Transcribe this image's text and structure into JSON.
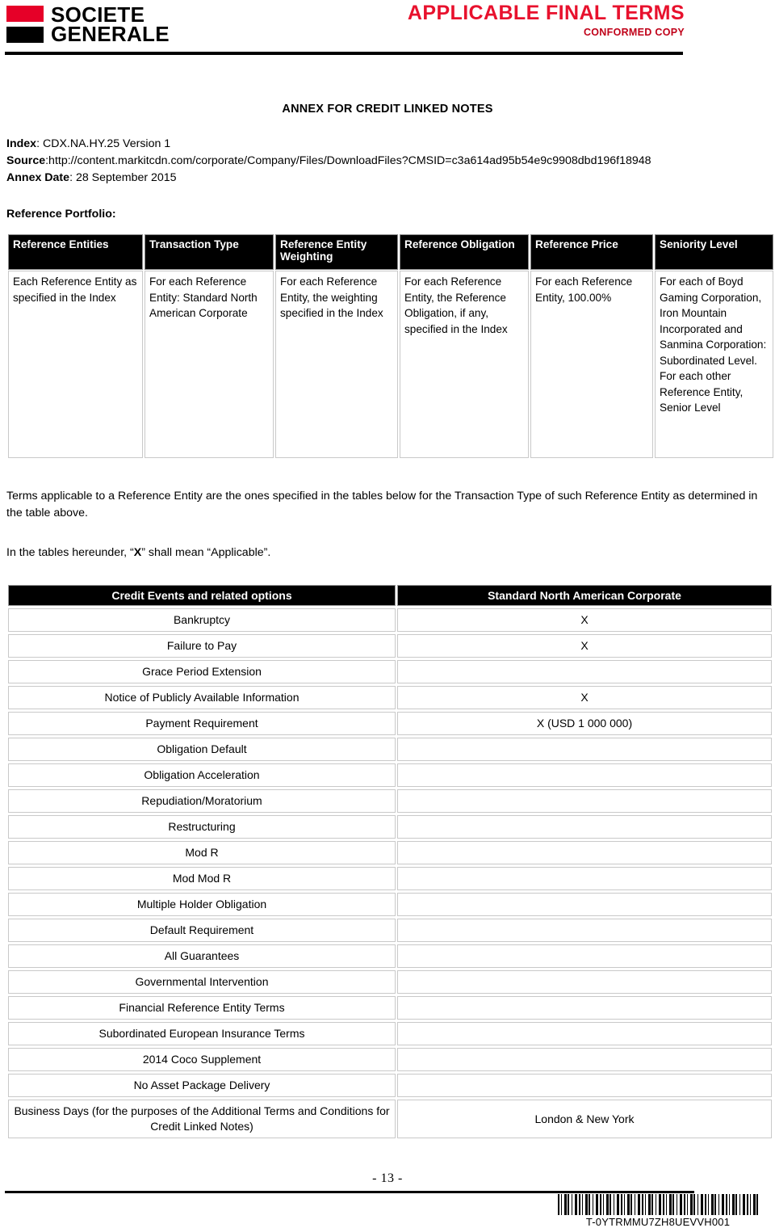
{
  "header": {
    "logo_line1": "SOCIETE",
    "logo_line2": "GENERALE",
    "title": "APPLICABLE FINAL TERMS",
    "subtitle": "CONFORMED COPY",
    "colors": {
      "brand_red": "#e60028",
      "title_red": "#e8112d"
    }
  },
  "document": {
    "annex_title": "ANNEX FOR CREDIT LINKED NOTES",
    "index_label": "Index",
    "index_value": ": CDX.NA.HY.25 Version 1",
    "source_label": "Source",
    "source_value": ":http://content.markitcdn.com/corporate/Company/Files/DownloadFiles?CMSID=c3a614ad95b54e9c9908dbd196f18948",
    "annex_date_label": "Annex Date",
    "annex_date_value": ": 28 September 2015",
    "reference_portfolio_label": "Reference Portfolio:"
  },
  "portfolio_table": {
    "headers": [
      "Reference Entities",
      "Transaction Type",
      "Reference Entity Weighting",
      "Reference Obligation",
      "Reference Price",
      "Seniority Level"
    ],
    "row": [
      "Each Reference Entity as specified in the Index",
      "For each Reference Entity: Standard North American Corporate",
      "For each Reference Entity, the weighting specified in the Index",
      "For each Reference Entity, the Reference Obligation, if any, specified in the Index",
      "For each Reference Entity, 100.00%",
      "For each of Boyd Gaming Corporation, Iron Mountain Incorporated and Sanmina Corporation: Subordinated Level. For each other Reference Entity, Senior Level"
    ]
  },
  "paragraphs": {
    "p1": "Terms applicable to a Reference Entity are the ones specified in the tables below for the Transaction Type of such Reference Entity as determined in the table above.",
    "p2_before": "In the tables hereunder, “",
    "p2_bold": "X",
    "p2_after": "” shall mean “Applicable”."
  },
  "credit_table": {
    "headers": [
      "Credit Events and related options",
      "Standard North American Corporate"
    ],
    "rows": [
      {
        "label": "Bankruptcy",
        "value": "X"
      },
      {
        "label": "Failure to Pay",
        "value": "X"
      },
      {
        "label": "Grace Period Extension",
        "value": ""
      },
      {
        "label": "Notice of Publicly Available Information",
        "value": "X"
      },
      {
        "label": "Payment Requirement",
        "value": "X (USD 1 000 000)"
      },
      {
        "label": "Obligation Default",
        "value": ""
      },
      {
        "label": "Obligation Acceleration",
        "value": ""
      },
      {
        "label": "Repudiation/Moratorium",
        "value": ""
      },
      {
        "label": "Restructuring",
        "value": ""
      },
      {
        "label": "Mod R",
        "value": ""
      },
      {
        "label": "Mod Mod R",
        "value": ""
      },
      {
        "label": "Multiple Holder Obligation",
        "value": ""
      },
      {
        "label": "Default Requirement",
        "value": ""
      },
      {
        "label": "All Guarantees",
        "value": ""
      },
      {
        "label": "Governmental Intervention",
        "value": ""
      },
      {
        "label": "Financial Reference Entity Terms",
        "value": ""
      },
      {
        "label": "Subordinated European Insurance Terms",
        "value": ""
      },
      {
        "label": "2014 Coco Supplement",
        "value": ""
      },
      {
        "label": "No Asset Package Delivery",
        "value": ""
      },
      {
        "label": "Business Days (for the purposes of the Additional Terms and Conditions for Credit Linked Notes)",
        "value": "London & New York"
      }
    ]
  },
  "footer": {
    "page_number": "- 13 -",
    "barcode_text": "T-0YTRMMU7ZH8UEVVH001"
  }
}
